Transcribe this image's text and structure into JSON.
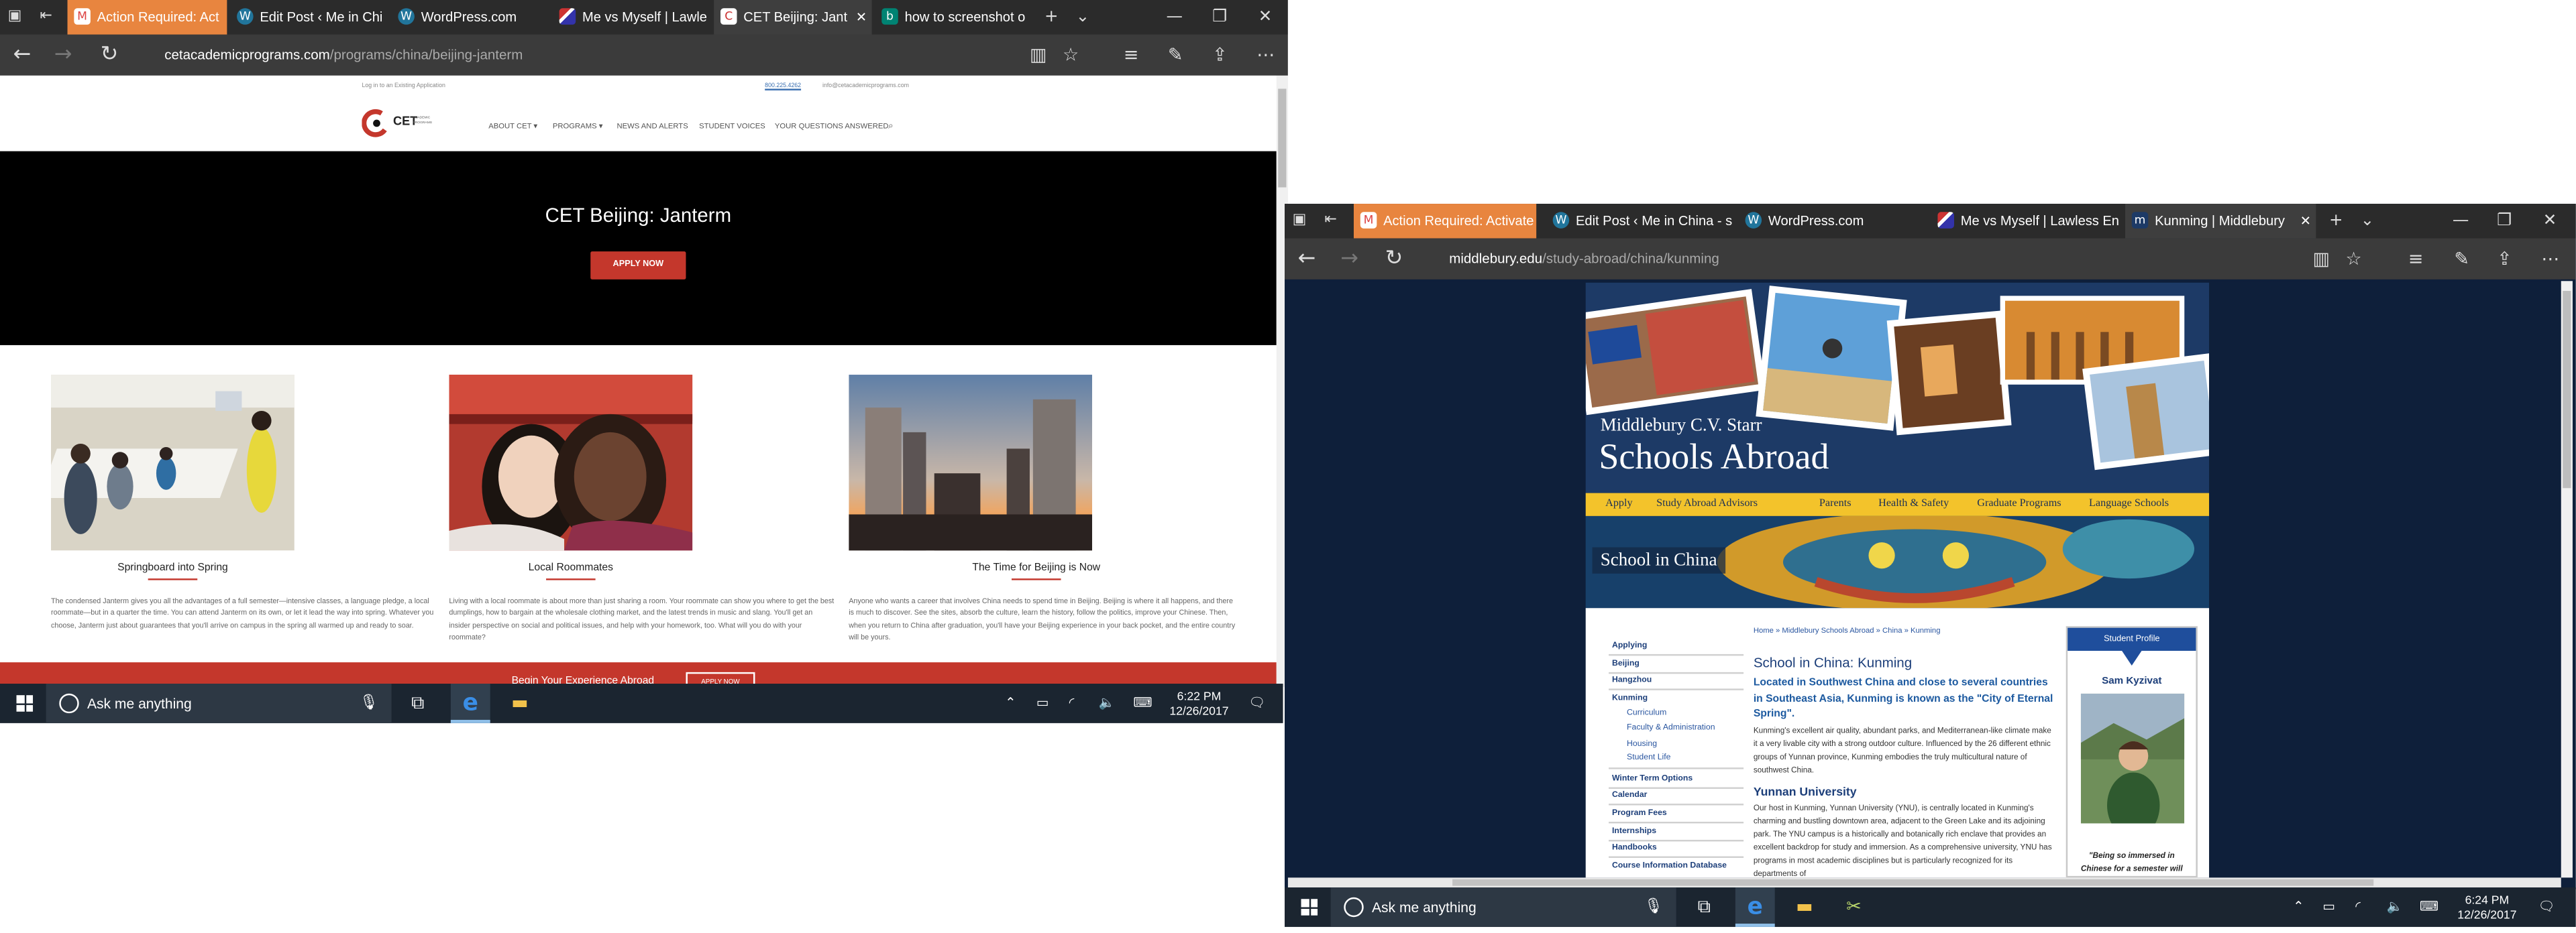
{
  "left_window": {
    "tabs": [
      {
        "label": "Action Required: Act",
        "icon": "gmail-icon",
        "active": false,
        "highlight": true
      },
      {
        "label": "Edit Post ‹ Me in Chi",
        "icon": "wordpress-icon",
        "active": false
      },
      {
        "label": "WordPress.com",
        "icon": "wordpress-icon",
        "active": false
      },
      {
        "label": "Me vs Myself | Lawle",
        "icon": "flag-icon",
        "active": false
      },
      {
        "label": "CET Beijing: Jant",
        "icon": "cet-icon",
        "active": true
      },
      {
        "label": "how to screenshot o",
        "icon": "bing-icon",
        "active": false
      }
    ],
    "url_domain": "cetacademicprograms.com",
    "url_path": "/programs/china/beijing-janterm"
  },
  "cet_page": {
    "toplinks": {
      "login": "Log in to an Existing Application",
      "phone": "800.225.4262",
      "email": "info@cetacademicprograms.com"
    },
    "logo_text": "CET",
    "logo_sub": "ACADEMIC PROGRAMS",
    "nav": [
      "ABOUT CET ▾",
      "PROGRAMS ▾",
      "NEWS AND ALERTS",
      "STUDENT VOICES",
      "YOUR QUESTIONS ANSWERED"
    ],
    "hero_title": "CET Beijing: Janterm",
    "apply_label": "APPLY NOW",
    "cards": [
      {
        "title": "Springboard into Spring",
        "text": "The condensed Janterm gives you all the advantages of a full semester—intensive classes, a language pledge, a local roommate—but in a quarter the time. You can attend Janterm on its own, or let it lead the way into spring. Whatever you choose, Janterm just about guarantees that you'll arrive on campus in the spring all warmed up and ready to soar."
      },
      {
        "title": "Local Roommates",
        "text": "Living with a local roommate is about more than just sharing a room. Your roommate can show you where to get the best dumplings, how to bargain at the wholesale clothing market, and the latest trends in music and slang. You'll get an insider perspective on social and political issues, and help with your homework, too. What will you do with your roommate?"
      },
      {
        "title": "The Time for Beijing is Now",
        "text": "Anyone who wants a career that involves China needs to spend time in Beijing. Beijing is where it all happens, and there is much to discover. See the sites, absorb the culture, learn the history, follow the politics, improve your Chinese. Then, when you return to China after graduation, you'll have your Beijing experience in your back pocket, and the entire country will be yours."
      }
    ],
    "banner_text": "Begin Your Experience Abroad",
    "banner_button": "APPLY NOW"
  },
  "left_taskbar": {
    "search_placeholder": "Ask me anything",
    "time": "6:22 PM",
    "date": "12/26/2017"
  },
  "right_window": {
    "tabs": [
      {
        "label": "Action Required: Activate",
        "icon": "gmail-icon",
        "active": false,
        "highlight": true
      },
      {
        "label": "Edit Post ‹ Me in China - s",
        "icon": "wordpress-icon",
        "active": false
      },
      {
        "label": "WordPress.com",
        "icon": "wordpress-icon",
        "active": false
      },
      {
        "label": "Me vs Myself | Lawless Eng",
        "icon": "flag-icon",
        "active": false
      },
      {
        "label": "Kunming | Middlebury",
        "icon": "middlebury-icon",
        "active": true
      }
    ],
    "url_domain": "middlebury.edu",
    "url_path": "/study-abroad/china/kunming"
  },
  "mb_page": {
    "title_small": "Middlebury C.V. Starr",
    "title_large": "Schools Abroad",
    "menu": [
      "Apply",
      "Study Abroad Advisors",
      "Parents",
      "Health & Safety",
      "Graduate Programs",
      "Language Schools"
    ],
    "banner_label": "School in China",
    "sidebar": [
      {
        "label": "Applying",
        "sub": false
      },
      {
        "label": "Beijing",
        "sub": false
      },
      {
        "label": "Hangzhou",
        "sub": false
      },
      {
        "label": "Kunming",
        "sub": false
      },
      {
        "label": "Curriculum",
        "sub": true
      },
      {
        "label": "Faculty & Administration",
        "sub": true
      },
      {
        "label": "Housing",
        "sub": true
      },
      {
        "label": "Student Life",
        "sub": true
      },
      {
        "label": "Winter Term Options",
        "sub": false
      },
      {
        "label": "Calendar",
        "sub": false
      },
      {
        "label": "Program Fees",
        "sub": false
      },
      {
        "label": "Internships",
        "sub": false
      },
      {
        "label": "Handbooks",
        "sub": false
      },
      {
        "label": "Course Information Database",
        "sub": false
      }
    ],
    "breadcrumb": "Home » Middlebury Schools Abroad » China » Kunming",
    "heading": "School in China: Kunming",
    "lead": "Located in Southwest China and close to several countries in Southeast Asia, Kunming is known as the \"City of Eternal Spring\".",
    "para1": "Kunming's excellent air quality, abundant parks, and Mediterranean-like climate make it a very livable city with a strong outdoor culture. Influenced by the 26 different ethnic groups of Yunnan province, Kunming embodies the truly multicultural nature of southwest China.",
    "heading2": "Yunnan University",
    "para2": "Our host in Kunming, Yunnan University (YNU), is centrally located in Kunming's charming and bustling downtown area, adjacent to the Green Lake and its adjoining park. The YNU campus is a historically and botanically rich enclave that provides an excellent backdrop for study and immersion. As a comprehensive university, YNU has programs in most academic disciplines but is particularly recognized for its departments of",
    "profile_header": "Student Profile",
    "profile_name": "Sam Kyzivat",
    "profile_quote": "\"Being so immersed in Chinese for a semester will have an incredible impact"
  },
  "right_taskbar": {
    "search_placeholder": "Ask me anything",
    "time": "6:24 PM",
    "date": "12/26/2017"
  },
  "colors": {
    "cet_red": "#c4372c",
    "mb_navy": "#1d3a66",
    "mb_gold": "#f3c32b",
    "taskbar": "#1b2530",
    "tabbar": "#2b2b2b",
    "highlight_tab": "#e8853f"
  }
}
